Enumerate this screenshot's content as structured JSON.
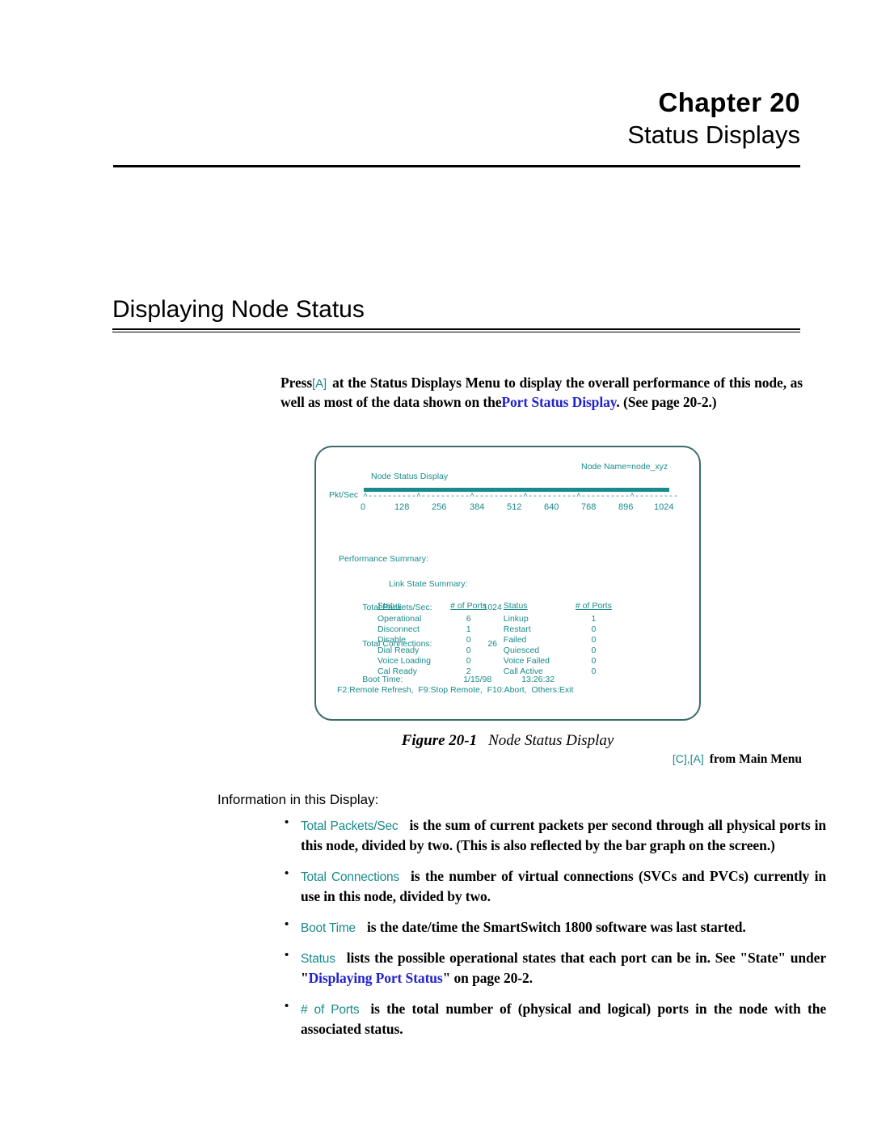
{
  "chapter": {
    "line1": "Chapter 20",
    "line2": "Status Displays"
  },
  "section": {
    "title": "Displaying Node Status"
  },
  "intro": {
    "part1": "Press",
    "key": "[A]",
    "part2": "at the Status Displays Menu to display the overall performance of this node, as well as most of the data shown on the",
    "link": "Port Status Display",
    "part3": ". (See page 20-2.)"
  },
  "terminal": {
    "node_name": "Node Name=node_xyz",
    "display_title": "Node Status Display",
    "bar_axis_label": "Pkt/Sec",
    "axis_ticks": "^----------^----------^----------^----------^----------^----------^----------^----------^",
    "scale_labels": [
      "0",
      "128",
      "256",
      "384",
      "512",
      "640",
      "768",
      "896",
      "1024"
    ],
    "performance": {
      "heading": "Performance Summary:",
      "rows": [
        {
          "label": "Total Packets/Sec:",
          "value": "1024",
          "value2": ""
        },
        {
          "label": "Total Connections:",
          "value": "26",
          "value2": ""
        },
        {
          "label": "Boot Time:",
          "value": "1/15/98",
          "value2": "13:26:32"
        }
      ]
    },
    "link_state": {
      "heading": "Link State Summary:",
      "headers": [
        "Status",
        "# of Ports",
        "Status",
        "# of Ports"
      ],
      "rows": [
        {
          "status_a": "Operational",
          "ports_a": "6",
          "status_b": "Linkup",
          "ports_b": "1"
        },
        {
          "status_a": "Disconnect",
          "ports_a": "1",
          "status_b": "Restart",
          "ports_b": "0"
        },
        {
          "status_a": "Disable",
          "ports_a": "0",
          "status_b": "Failed",
          "ports_b": "0"
        },
        {
          "status_a": "Dial Ready",
          "ports_a": "0",
          "status_b": "Quiesced",
          "ports_b": "0"
        },
        {
          "status_a": "Voice Loading",
          "ports_a": "0",
          "status_b": "Voice Failed",
          "ports_b": "0"
        },
        {
          "status_a": "Cal Ready",
          "ports_a": "2",
          "status_b": "Call Active",
          "ports_b": "0"
        }
      ]
    },
    "function_keys": "F2:Remote Refresh,  F9:Stop Remote,  F10:Abort,  Others:Exit"
  },
  "figure": {
    "number": "Figure 20-1",
    "title": "Node Status Display",
    "keys": "[C],[A]",
    "from": "from Main Menu"
  },
  "info": {
    "lead": "Information in this Display:",
    "bullets": [
      {
        "term": "Total Packets/Sec",
        "text": "is the sum of current packets per second through all physical ports in this node, divided by two. (This is also reflected by the bar graph on the screen.)"
      },
      {
        "term": "Total Connections",
        "text": "is the number of virtual connections (SVCs and PVCs) currently in use in this node, divided by two."
      },
      {
        "term": "Boot Time",
        "text": "is the date/time the SmartSwitch 1800 software was last started."
      },
      {
        "term": "Status",
        "text_before": "lists the possible operational states that each port can be in. See \"State\" under \"",
        "link": "Displaying Port Status",
        "text_after": "\" on page 20-2."
      },
      {
        "term": "# of Ports",
        "text": "is the total number of (physical and logical) ports in the node with the associated status."
      }
    ]
  },
  "colors": {
    "terminal_teal": "#1a8a8a",
    "terminal_border": "#3d6b6b",
    "hyperlink_blue": "#2222cc",
    "body_black": "#000000"
  }
}
